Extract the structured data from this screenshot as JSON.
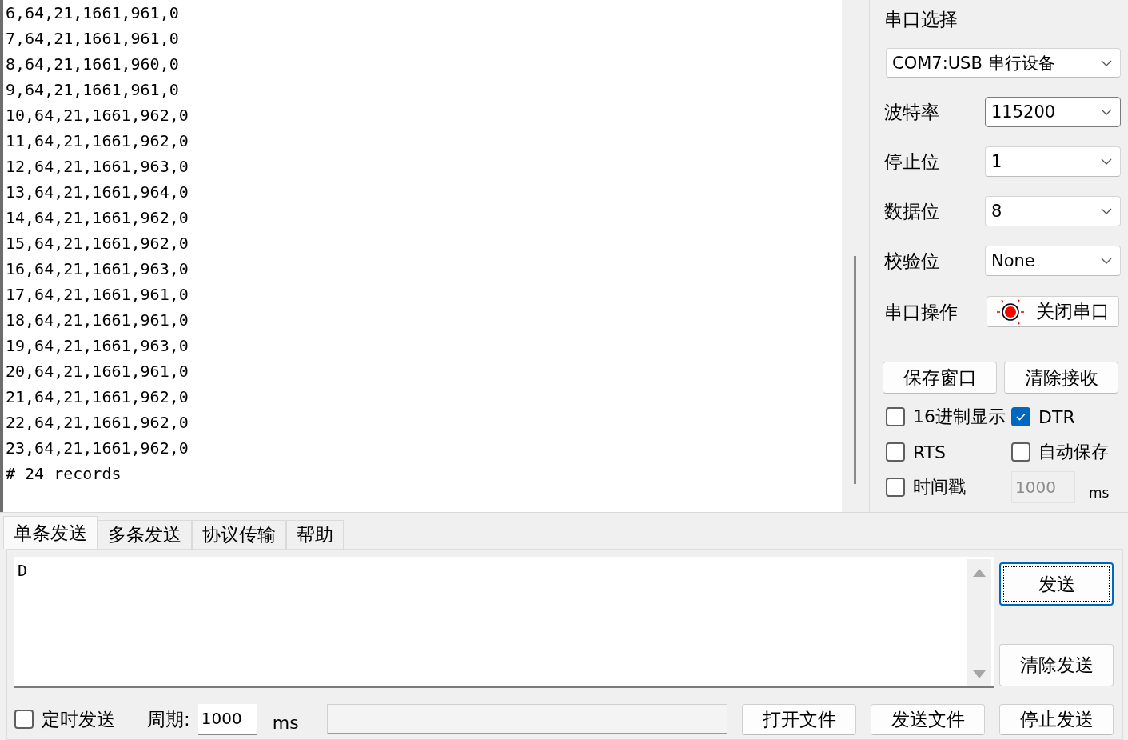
{
  "receive_log": {
    "lines": [
      "6,64,21,1661,961,0",
      "7,64,21,1661,961,0",
      "8,64,21,1661,960,0",
      "9,64,21,1661,961,0",
      "10,64,21,1661,962,0",
      "11,64,21,1661,962,0",
      "12,64,21,1661,963,0",
      "13,64,21,1661,964,0",
      "14,64,21,1661,962,0",
      "15,64,21,1661,962,0",
      "16,64,21,1661,963,0",
      "17,64,21,1661,961,0",
      "18,64,21,1661,961,0",
      "19,64,21,1661,963,0",
      "20,64,21,1661,961,0",
      "21,64,21,1661,962,0",
      "22,64,21,1661,962,0",
      "23,64,21,1661,962,0",
      "# 24 records"
    ]
  },
  "serial": {
    "port_label": "串口选择",
    "port": "COM7:USB 串行设备",
    "settings": [
      {
        "label": "波特率",
        "value": "115200",
        "focused": true
      },
      {
        "label": "停止位",
        "value": "1",
        "focused": false
      },
      {
        "label": "数据位",
        "value": "8",
        "focused": false
      },
      {
        "label": "校验位",
        "value": "None",
        "focused": false
      }
    ],
    "operation_label": "串口操作",
    "toggle_button": "关闭串口",
    "buttons": [
      "保存窗口",
      "清除接收"
    ],
    "options": [
      {
        "label": "16进制显示",
        "checked": false
      },
      {
        "label": "DTR",
        "checked": true
      },
      {
        "label": "RTS",
        "checked": false
      },
      {
        "label": "自动保存",
        "checked": false
      },
      {
        "label": "时间戳",
        "checked": false
      }
    ],
    "timestamp_interval": {
      "value": "1000",
      "disabled": true
    },
    "timestamp_unit": "ms"
  },
  "send_panel": {
    "tabs": [
      {
        "label": "单条发送",
        "selected": true
      },
      {
        "label": "多条发送",
        "selected": false
      },
      {
        "label": "协议传输",
        "selected": false
      },
      {
        "label": "帮助",
        "selected": false
      }
    ],
    "input": {
      "value": "D"
    },
    "send_button": {
      "label": "发送",
      "focused": true
    },
    "clear_button": "清除发送",
    "timed_send": {
      "label": "定时发送",
      "checked": false
    },
    "period_label": "周期:",
    "period": {
      "value": "1000"
    },
    "period_unit": "ms",
    "file_buttons": [
      "打开文件",
      "发送文件",
      "停止发送"
    ]
  }
}
